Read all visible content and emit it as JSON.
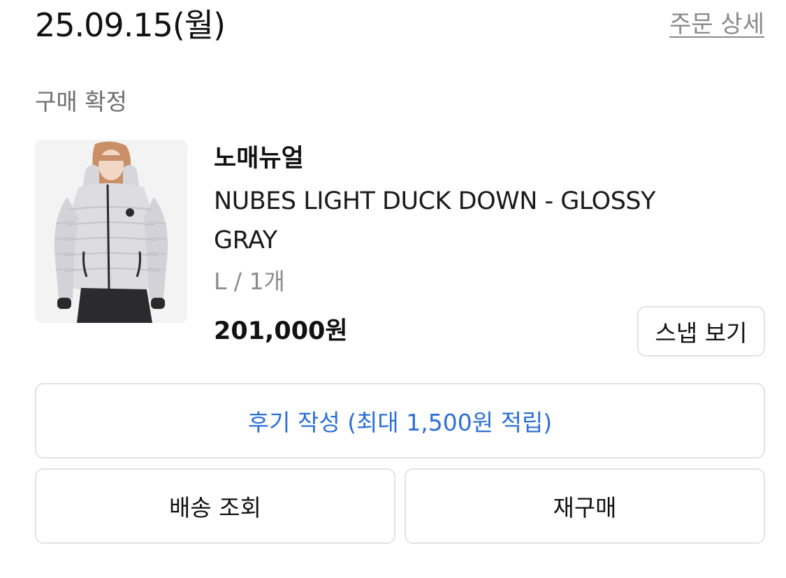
{
  "order": {
    "date": "25.09.15(월)",
    "detail_link": "주문 상세",
    "status": "구매 확정"
  },
  "product": {
    "image_icon": "product-photo-icon",
    "brand": "노매뉴얼",
    "name": "NUBES LIGHT DUCK DOWN - GLOSSY GRAY",
    "option": "L / 1개",
    "price": "201,000원"
  },
  "actions": {
    "snap_label": "스냅 보기",
    "review_label": "후기 작성 (최대 1,500원 적립)",
    "shipping_label": "배송 조회",
    "rebuy_label": "재구매"
  },
  "colors": {
    "accent_blue": "#2d6fd9",
    "status_gray": "#6e6e6e",
    "border_gray": "#e3e3e3"
  }
}
